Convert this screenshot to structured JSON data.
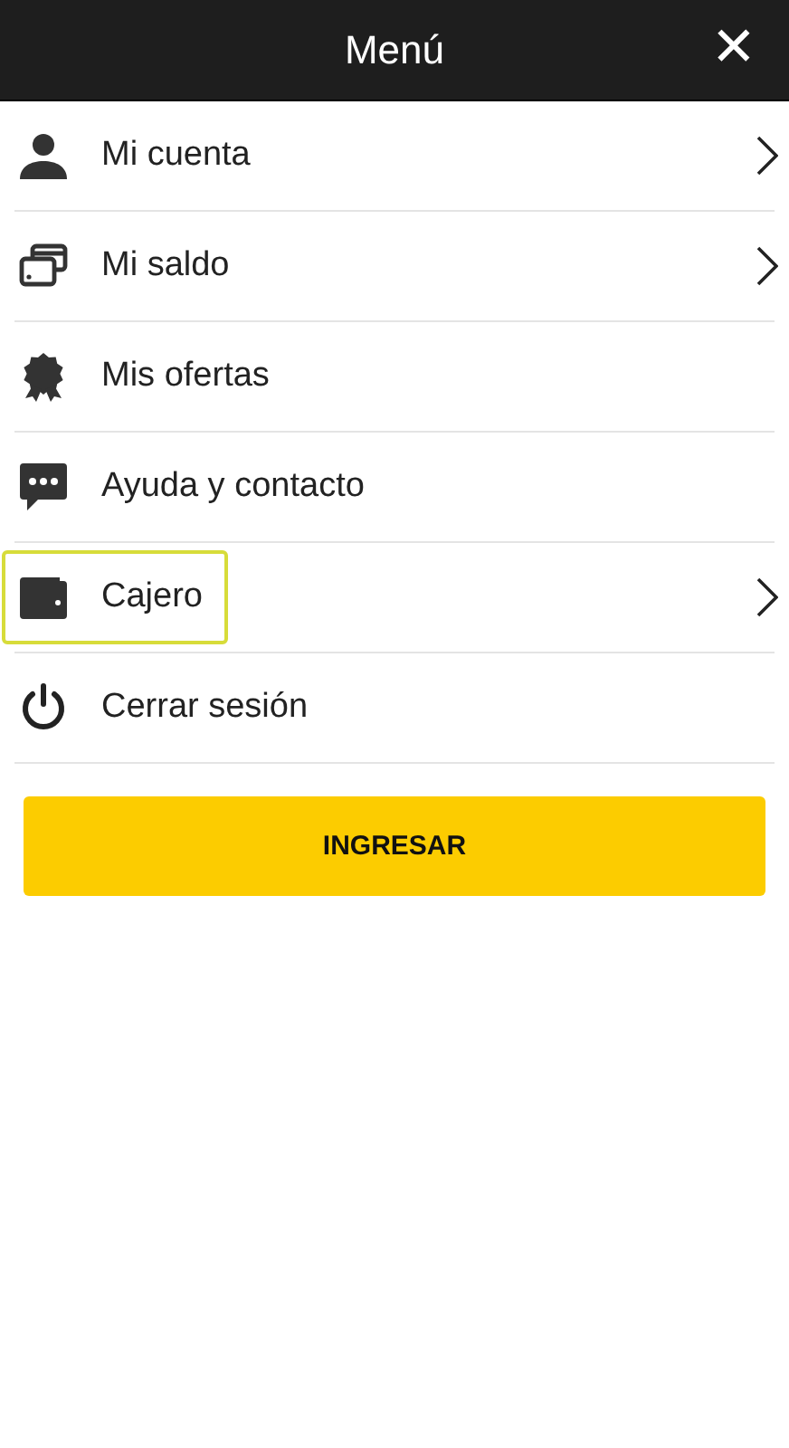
{
  "header": {
    "title": "Menú",
    "close": "✕"
  },
  "items": [
    {
      "label": "Mi cuenta",
      "submenu": true,
      "focused": false
    },
    {
      "label": "Mi saldo",
      "submenu": true,
      "focused": false
    },
    {
      "label": "Mis ofertas",
      "submenu": false,
      "focused": false
    },
    {
      "label": "Ayuda y contacto",
      "submenu": false,
      "focused": false
    },
    {
      "label": "Cajero",
      "submenu": true,
      "focused": true
    },
    {
      "label": "Cerrar sesión",
      "submenu": false,
      "focused": false
    }
  ],
  "button": {
    "label": "INGRESAR"
  }
}
